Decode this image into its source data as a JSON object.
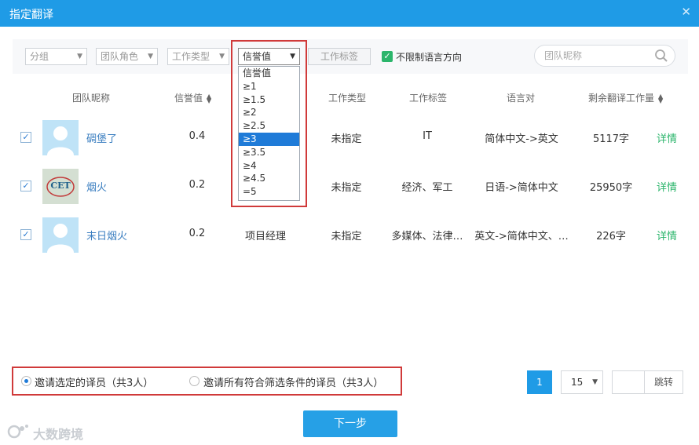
{
  "dialog": {
    "title": "指定翻译",
    "close_icon": "close-icon"
  },
  "filters": {
    "group": {
      "value": "分组"
    },
    "team_role": {
      "value": "团队角色"
    },
    "work_type": {
      "value": "工作类型"
    },
    "credit": {
      "value": "信誉值"
    },
    "work_tag_button": "工作标签",
    "unrestricted_lang_label": "不限制语言方向",
    "unrestricted_lang_checked": true,
    "search_placeholder": "团队昵称"
  },
  "credit_dropdown": {
    "options": [
      "信誉值",
      "≥1",
      "≥1.5",
      "≥2",
      "≥2.5",
      "≥3",
      "≥3.5",
      "≥4",
      "≥4.5",
      "=5"
    ],
    "selected_index": 5
  },
  "table": {
    "headers": {
      "nickname": "团队昵称",
      "credit": "信誉值",
      "work_type": "工作类型",
      "work_tag": "工作标签",
      "lang_pair": "语言对",
      "remaining": "剩余翻译工作量"
    },
    "rows": [
      {
        "checked": true,
        "avatar": "default-user-avatar",
        "name": "碉堡了",
        "credit": "0.4",
        "role": "",
        "work_type": "未指定",
        "work_tag": "IT",
        "lang_pair": "简体中文->英文",
        "remaining": "5117字",
        "detail": "详情"
      },
      {
        "checked": true,
        "avatar": "cet-logo-avatar",
        "avatar_text": "CET",
        "name": "烟火",
        "credit": "0.2",
        "role": "",
        "work_type": "未指定",
        "work_tag": "经济、军工",
        "lang_pair": "日语->简体中文",
        "remaining": "25950字",
        "detail": "详情"
      },
      {
        "checked": true,
        "avatar": "default-user-avatar",
        "name": "末日烟火",
        "credit": "0.2",
        "role": "项目经理",
        "work_type": "未指定",
        "work_tag": "多媒体、法律…",
        "lang_pair": "英文->简体中文、…",
        "remaining": "226字",
        "detail": "详情"
      }
    ]
  },
  "invite": {
    "selected_label": "邀请选定的译员（共3人）",
    "all_label": "邀请所有符合筛选条件的译员（共3人）",
    "selected_option": "selected"
  },
  "pagination": {
    "current_page": "1",
    "page_size": "15",
    "jump_label": "跳转",
    "jump_value": ""
  },
  "next_button": "下一步",
  "watermark": {
    "text": "大数跨境"
  },
  "colors": {
    "primary": "#1f9be6",
    "success": "#2bb56b",
    "link": "#3a7ec0",
    "highlight_border": "#d03a3a",
    "selected_option": "#1f7bd8"
  }
}
